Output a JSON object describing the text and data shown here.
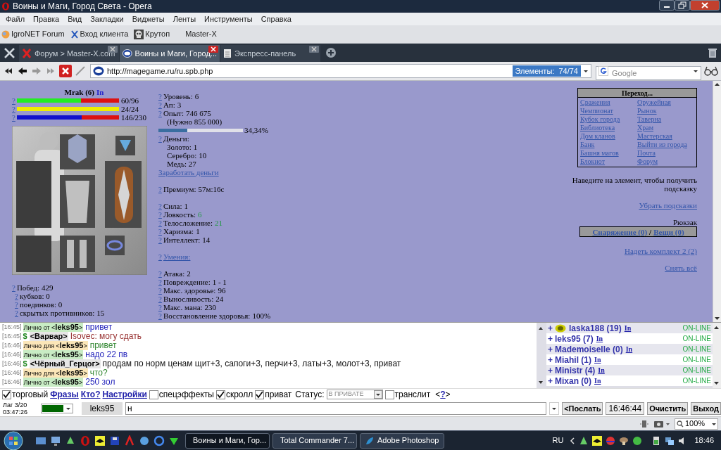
{
  "window": {
    "title": "Воины и Маги, Город Света - Opera"
  },
  "menu": [
    "Файл",
    "Правка",
    "Вид",
    "Закладки",
    "Виджеты",
    "Ленты",
    "Инструменты",
    "Справка"
  ],
  "bookmarks": [
    {
      "label": "IgroNET Forum",
      "kind": "globe"
    },
    {
      "label": "Вход клиента",
      "kind": "cross"
    },
    {
      "label": "Крутоп",
      "kind": "skull"
    },
    {
      "label": "Master-X",
      "kind": "plain"
    }
  ],
  "tabs": [
    {
      "label": "Форум > Master-X.com",
      "selected": false,
      "kind": "cross"
    },
    {
      "label": "Воины и Маги, Город...",
      "selected": true,
      "kind": "site"
    },
    {
      "label": "Экспресс-панель",
      "selected": false,
      "kind": "page"
    }
  ],
  "address": {
    "url": "http://magegame.ru/ru.spb.php",
    "elements": "Элементы:  74/74"
  },
  "search": {
    "placeholder": "Google"
  },
  "character": {
    "name": "Mrak (6)",
    "status": "In",
    "bars": [
      {
        "help": "?",
        "level": 0.625,
        "color": "#22ee22",
        "reading": "60/96"
      },
      {
        "help": "?",
        "level": 1,
        "color": "#eeee00",
        "reading": "24/24"
      },
      {
        "help": "?",
        "level": 0.635,
        "color": "#1111cc",
        "reading": "146/230"
      }
    ],
    "records": [
      {
        "help": "?",
        "text": "Побед: 429",
        "children": [
          {
            "help": "?",
            "text": "кубков: 0"
          },
          {
            "help": "?",
            "text": "поединков: 0"
          },
          {
            "help": "?",
            "text": "скрытых противников: 15"
          }
        ]
      }
    ]
  },
  "stats": [
    [
      {
        "kind": "stat",
        "help": "?",
        "label": "Уровень:",
        "value": "6",
        "bonus": false
      },
      {
        "kind": "stat",
        "help": "?",
        "label": "Ап:",
        "value": "3",
        "bonus": false
      },
      {
        "kind": "stat",
        "help": "?",
        "label": "Опыт:",
        "value": "746 675",
        "bonus": false,
        "children": [
          {
            "text": "(Нужно 855 000)"
          }
        ]
      },
      {
        "kind": "progress",
        "level": 0.3434,
        "reading": "34,34%"
      },
      {
        "kind": "stat",
        "help": "?",
        "label": "Деньги:",
        "children": [
          {
            "text": "Золото: 1"
          },
          {
            "text": "Серебро: 10"
          },
          {
            "text": "Медь: 27"
          }
        ]
      },
      {
        "kind": "link",
        "label": "Заработать деньги"
      }
    ],
    [
      {
        "kind": "stat",
        "help": "?",
        "label": "Премиум:",
        "value": "57м:16с",
        "bonus": false
      }
    ],
    [
      {
        "kind": "stat",
        "help": "?",
        "label": "Сила:",
        "value": "1",
        "bonus": false
      },
      {
        "kind": "stat",
        "help": "?",
        "label": "Ловкость:",
        "value": "6",
        "bonus": true
      },
      {
        "kind": "stat",
        "help": "?",
        "label": "Телосложение:",
        "value": "21",
        "bonus": true
      },
      {
        "kind": "stat",
        "help": "?",
        "label": "Харизма:",
        "value": "1",
        "bonus": false
      },
      {
        "kind": "stat",
        "help": "?",
        "label": "Интеллект:",
        "value": "14",
        "bonus": false
      }
    ],
    [
      {
        "kind": "link",
        "help": "?",
        "label": "Умения:"
      }
    ],
    [
      {
        "kind": "stat",
        "help": "?",
        "label": "Атака:",
        "value": "2",
        "bonus": false
      },
      {
        "kind": "stat",
        "help": "?",
        "label": "Повреждение:",
        "value": "1 - 1",
        "bonus": false
      },
      {
        "kind": "stat",
        "help": "?",
        "label": "Макс. здоровье:",
        "value": "96",
        "bonus": false
      },
      {
        "kind": "stat",
        "help": "?",
        "label": "Выносливость:",
        "value": "24",
        "bonus": false
      },
      {
        "kind": "stat",
        "help": "?",
        "label": "Макс. мана:",
        "value": "230",
        "bonus": false
      },
      {
        "kind": "stat",
        "help": "?",
        "label": "Восстановление здоровья:",
        "value": "100%",
        "bonus": false
      }
    ]
  ],
  "navigation": {
    "title": "Переход...",
    "links": [
      "Сражения",
      "Оружейная",
      "Чемпионат",
      "Рынок",
      "Кубок города",
      "Таверна",
      "Библиотека",
      "Храм",
      "Дом кланов",
      "Мастерская",
      "Банк",
      "Выйти из города",
      "Башня магов",
      "Почта",
      "Блокнот",
      "Форум"
    ]
  },
  "hint": "Наведите на элемент, чтобы получить подсказку",
  "hide_hints": "Убрать подсказки",
  "backpack": {
    "title": "Рюкзак",
    "links": [
      "Снаряжение (0)",
      "Вещи (0)"
    ],
    "separator": "/"
  },
  "wear_set": "Надеть комплект 2 (2)",
  "remove_all": "Снять всё",
  "chat": [
    {
      "time": "[16:45]",
      "kind": "private_from",
      "tag": "Лично от <**leks95**>",
      "text": "привет",
      "color": "#2222bb"
    },
    {
      "time": "[16:45]",
      "kind": "trade",
      "mark": "$",
      "sender": "<Варвар>",
      "text": "Isovec: могу сдать",
      "color": "#993333"
    },
    {
      "time": "[16:46]",
      "kind": "private_to",
      "tag": "Лично для <**leks95**>",
      "text": "привет",
      "color": "#338833"
    },
    {
      "time": "[16:46]",
      "kind": "private_from",
      "tag": "Лично от <**leks95**>",
      "text": "надо 22 пв",
      "color": "#2222bb"
    },
    {
      "time": "[16:46]",
      "kind": "trade",
      "mark": "$",
      "sender": "<Чёрный_Герцог>",
      "text": "продам по норм ценам щит+3, сапоги+3, перчи+3, латы+3, молот+3, приват",
      "color": "#111111"
    },
    {
      "time": "[16:46]",
      "kind": "private_to",
      "tag": "Лично для <**leks95**>",
      "text": "что?",
      "color": "#338833"
    },
    {
      "time": "[16:46]",
      "kind": "private_from",
      "tag": "Лично от <**leks95**>",
      "text": "250 зол",
      "color": "#2222bb"
    }
  ],
  "users": [
    {
      "plus": "+",
      "name": "laska188 (19)",
      "link": "In",
      "state": "ON-LINE",
      "badge": true
    },
    {
      "plus": "+",
      "name": "leks95 (7)",
      "link": "In",
      "state": "ON-LINE",
      "badge": false
    },
    {
      "plus": "+",
      "name": "Mademoiselle (0)",
      "link": "In",
      "state": "ON-LINE",
      "badge": false
    },
    {
      "plus": "+",
      "name": "Miahil (1)",
      "link": "In",
      "state": "ON-LINE",
      "badge": false
    },
    {
      "plus": "+",
      "name": "Ministr (4)",
      "link": "In",
      "state": "ON-LINE",
      "badge": false
    },
    {
      "plus": "+",
      "name": "Mixan (0)",
      "link": "In",
      "state": "ON-LINE",
      "badge": false
    }
  ],
  "options": [
    {
      "kind": "checkbox",
      "label": "торговый",
      "checked": true
    },
    {
      "kind": "link",
      "label": "Фразы"
    },
    {
      "kind": "link",
      "label": "Кто?"
    },
    {
      "kind": "link",
      "label": "Настройки"
    },
    {
      "kind": "checkbox",
      "label": "спецэффекты",
      "checked": false
    },
    {
      "kind": "checkbox",
      "label": "скролл",
      "checked": true
    },
    {
      "kind": "checkbox",
      "label": "приват",
      "checked": true
    },
    {
      "kind": "select",
      "label": "Статус:",
      "value": "В ПРИВАТЕ"
    },
    {
      "kind": "checkbox",
      "label": "транслит",
      "checked": false
    },
    {
      "kind": "help",
      "before": "<",
      "label": "?",
      "after": ">"
    }
  ],
  "input_row": {
    "lag": "Лаг 3/20",
    "uptime": "03:47:26",
    "color": "#006600",
    "nick": "leks95",
    "message": "н",
    "send": "<Послать",
    "clock": "16:46:44",
    "buttons": [
      "Очистить",
      "Выход"
    ]
  },
  "status_bar": {
    "zoom": "100%"
  },
  "taskbar": {
    "tasks": [
      {
        "label": "Воины и Маги, Гор...",
        "selected": true,
        "kind": "opera"
      },
      {
        "label": "Total Commander 7...",
        "selected": false,
        "kind": "disk"
      },
      {
        "label": "Adobe Photoshop",
        "selected": false,
        "kind": "feather"
      }
    ],
    "language": "RU",
    "clock": "18:46"
  }
}
